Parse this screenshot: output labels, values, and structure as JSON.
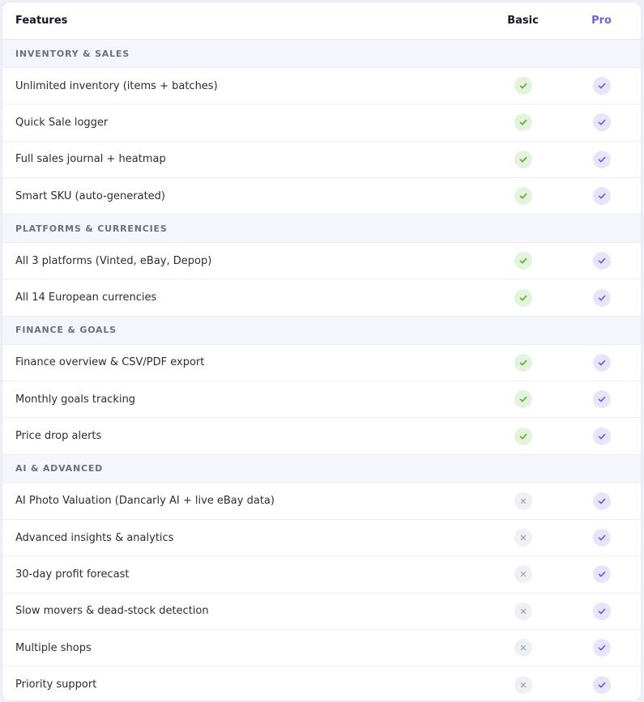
{
  "header": {
    "features": "Features",
    "basic": "Basic",
    "pro": "Pro"
  },
  "colors": {
    "basic_check": "#5aae3a",
    "pro_check": "#6c63d9",
    "cross": "#a3a8b6"
  },
  "sections": [
    {
      "title": "INVENTORY & SALES",
      "rows": [
        {
          "label": "Unlimited inventory (items + batches)",
          "basic": true,
          "pro": true
        },
        {
          "label": "Quick Sale logger",
          "basic": true,
          "pro": true
        },
        {
          "label": "Full sales journal + heatmap",
          "basic": true,
          "pro": true
        },
        {
          "label": "Smart SKU (auto-generated)",
          "basic": true,
          "pro": true
        }
      ]
    },
    {
      "title": "PLATFORMS & CURRENCIES",
      "rows": [
        {
          "label": "All 3 platforms (Vinted, eBay, Depop)",
          "basic": true,
          "pro": true
        },
        {
          "label": "All 14 European currencies",
          "basic": true,
          "pro": true
        }
      ]
    },
    {
      "title": "FINANCE & GOALS",
      "rows": [
        {
          "label": "Finance overview & CSV/PDF export",
          "basic": true,
          "pro": true
        },
        {
          "label": "Monthly goals tracking",
          "basic": true,
          "pro": true
        },
        {
          "label": "Price drop alerts",
          "basic": true,
          "pro": true
        }
      ]
    },
    {
      "title": "AI & ADVANCED",
      "rows": [
        {
          "label": "AI Photo Valuation (Dancarly AI + live eBay data)",
          "basic": false,
          "pro": true
        },
        {
          "label": "Advanced insights & analytics",
          "basic": false,
          "pro": true
        },
        {
          "label": "30-day profit forecast",
          "basic": false,
          "pro": true
        },
        {
          "label": "Slow movers & dead-stock detection",
          "basic": false,
          "pro": true
        },
        {
          "label": "Multiple shops",
          "basic": false,
          "pro": true
        },
        {
          "label": "Priority support",
          "basic": false,
          "pro": true
        }
      ]
    }
  ]
}
